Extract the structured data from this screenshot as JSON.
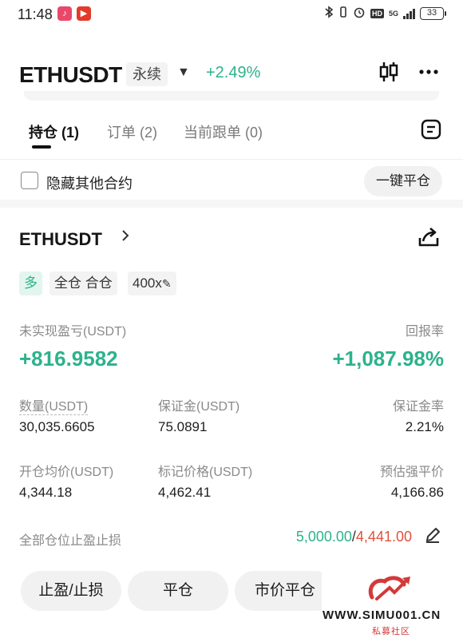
{
  "status_bar": {
    "time": "11:48",
    "net": "5G",
    "battery": "33"
  },
  "header": {
    "symbol": "ETHUSDT",
    "contract_type": "永续",
    "change": "+2.49%",
    "icons": [
      "kline-icon",
      "more-icon"
    ]
  },
  "tabs": [
    {
      "label": "持仓 (1)",
      "active": true
    },
    {
      "label": "订单 (2)",
      "active": false
    },
    {
      "label": "当前跟单 (0)",
      "active": false
    }
  ],
  "filter": {
    "hide_other_label": "隐藏其他合约",
    "checked": false,
    "close_all_label": "一键平仓"
  },
  "position": {
    "symbol": "ETHUSDT",
    "side_tag": "多",
    "margin_tag": "全仓 合仓",
    "leverage_tag": "400x",
    "unrealized_pnl_label": "未实现盈亏(USDT)",
    "unrealized_pnl": "+816.9582",
    "roe_label": "回报率",
    "roe": "+1,087.98%",
    "qty_label": "数量(USDT)",
    "qty": "30,035.6605",
    "margin_label": "保证金(USDT)",
    "margin": "75.0891",
    "margin_ratio_label": "保证金率",
    "margin_ratio": "2.21%",
    "entry_label": "开仓均价(USDT)",
    "entry": "4,344.18",
    "mark_label": "标记价格(USDT)",
    "mark": "4,462.41",
    "liq_label": "预估强平价",
    "liq": "4,166.86",
    "tpsl_label": "全部仓位止盈止损",
    "tp": "5,000.00",
    "sl": "4,441.00",
    "separator": "/"
  },
  "actions": {
    "tpsl": "止盈/止损",
    "close": "平仓",
    "market_close": "市价平仓"
  },
  "watermark": {
    "url": "WWW.SIMU001.CN",
    "name": "私募社区"
  },
  "colors": {
    "up": "#2db28c",
    "down": "#e0523f"
  }
}
